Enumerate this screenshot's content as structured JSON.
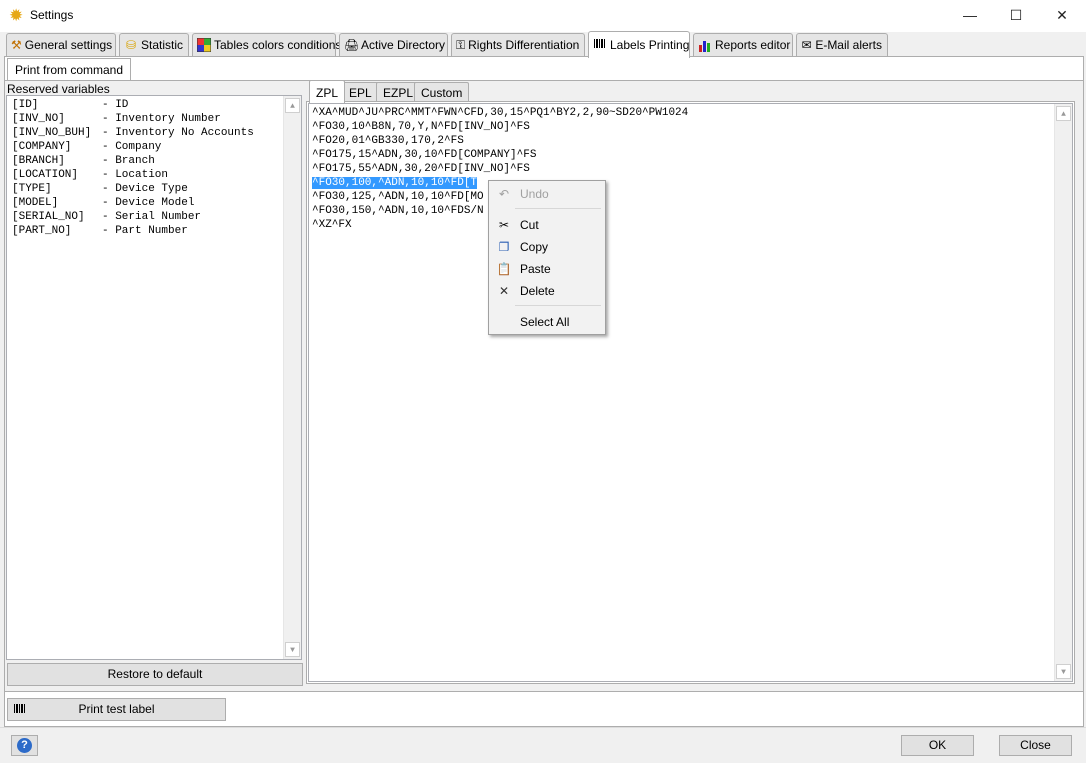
{
  "window": {
    "title": "Settings",
    "minimize_glyph": "—",
    "maximize_glyph": "☐",
    "close_glyph": "✕"
  },
  "tabs": [
    {
      "label": "General settings",
      "icon": "tools-icon"
    },
    {
      "label": "Statistic",
      "icon": "database-icon"
    },
    {
      "label": "Tables colors conditions",
      "icon": "color-grid-icon"
    },
    {
      "label": "Active Directory",
      "icon": "directory-icon"
    },
    {
      "label": "Rights Differentiation",
      "icon": "key-icon"
    },
    {
      "label": "Labels Printing",
      "icon": "barcode-icon"
    },
    {
      "label": "Reports editor",
      "icon": "report-icon"
    },
    {
      "label": "E-Mail alerts",
      "icon": "email-icon"
    }
  ],
  "subtab": {
    "label": "Print from command"
  },
  "reserved": {
    "label": "Reserved variables",
    "items": [
      {
        "var": "[ID]",
        "desc": "ID"
      },
      {
        "var": "[INV_NO]",
        "desc": "Inventory Number"
      },
      {
        "var": "[INV_NO_BUH]",
        "desc": "Inventory No Accounts"
      },
      {
        "var": "[COMPANY]",
        "desc": "Company"
      },
      {
        "var": "[BRANCH]",
        "desc": "Branch"
      },
      {
        "var": "[LOCATION]",
        "desc": "Location"
      },
      {
        "var": "[TYPE]",
        "desc": "Device Type"
      },
      {
        "var": "[MODEL]",
        "desc": "Device Model"
      },
      {
        "var": "[SERIAL_NO]",
        "desc": "Serial Number"
      },
      {
        "var": "[PART_NO]",
        "desc": "Part Number"
      }
    ],
    "restore_label": "Restore to default"
  },
  "printer_tabs": [
    "ZPL",
    "EPL",
    "EZPL",
    "Custom"
  ],
  "editor": {
    "lines": [
      "^XA^MUD^JU^PRC^MMT^FWN^CFD,30,15^PQ1^BY2,2,90~SD20^PW1024",
      "^FO30,10^B8N,70,Y,N^FD[INV_NO]^FS",
      "^FO20,01^GB330,170,2^FS",
      "^FO175,15^ADN,30,10^FD[COMPANY]^FS",
      "^FO175,55^ADN,30,20^FD[INV_NO]^FS",
      "^FO30,100,^ADN,10,10^FD[TYPE]^FS",
      "^FO30,125,^ADN,10,10^FD[MODEL]^FS",
      "^FO30,150,^ADN,10,10^FDS/N:[SERIAL_NO]^FS",
      "^XZ^FX"
    ],
    "visible": [
      "^XA^MUD^JU^PRC^MMT^FWN^CFD,30,15^PQ1^BY2,2,90~SD20^PW1024",
      "^FO30,10^B8N,70,Y,N^FD[INV_NO]^FS",
      "^FO20,01^GB330,170,2^FS",
      "^FO175,15^ADN,30,10^FD[COMPANY]^FS",
      "^FO175,55^ADN,30,20^FD[INV_NO]^FS",
      "^FO30,100,^ADN,10,10^FD[T",
      "^FO30,125,^ADN,10,10^FD[MO",
      "^FO30,150,^ADN,10,10^FDS/N",
      "^XZ^FX"
    ]
  },
  "context_menu": {
    "items": [
      {
        "label": "Undo",
        "icon": "undo-icon",
        "enabled": false
      },
      {
        "label": "Cut",
        "icon": "scissors-icon",
        "enabled": true
      },
      {
        "label": "Copy",
        "icon": "copy-icon",
        "enabled": true
      },
      {
        "label": "Paste",
        "icon": "paste-icon",
        "enabled": true
      },
      {
        "label": "Delete",
        "icon": "delete-icon",
        "enabled": true
      },
      {
        "label": "Select All",
        "icon": "",
        "enabled": true
      }
    ]
  },
  "print_test_label": "Print test label",
  "footer": {
    "ok": "OK",
    "close": "Close"
  }
}
